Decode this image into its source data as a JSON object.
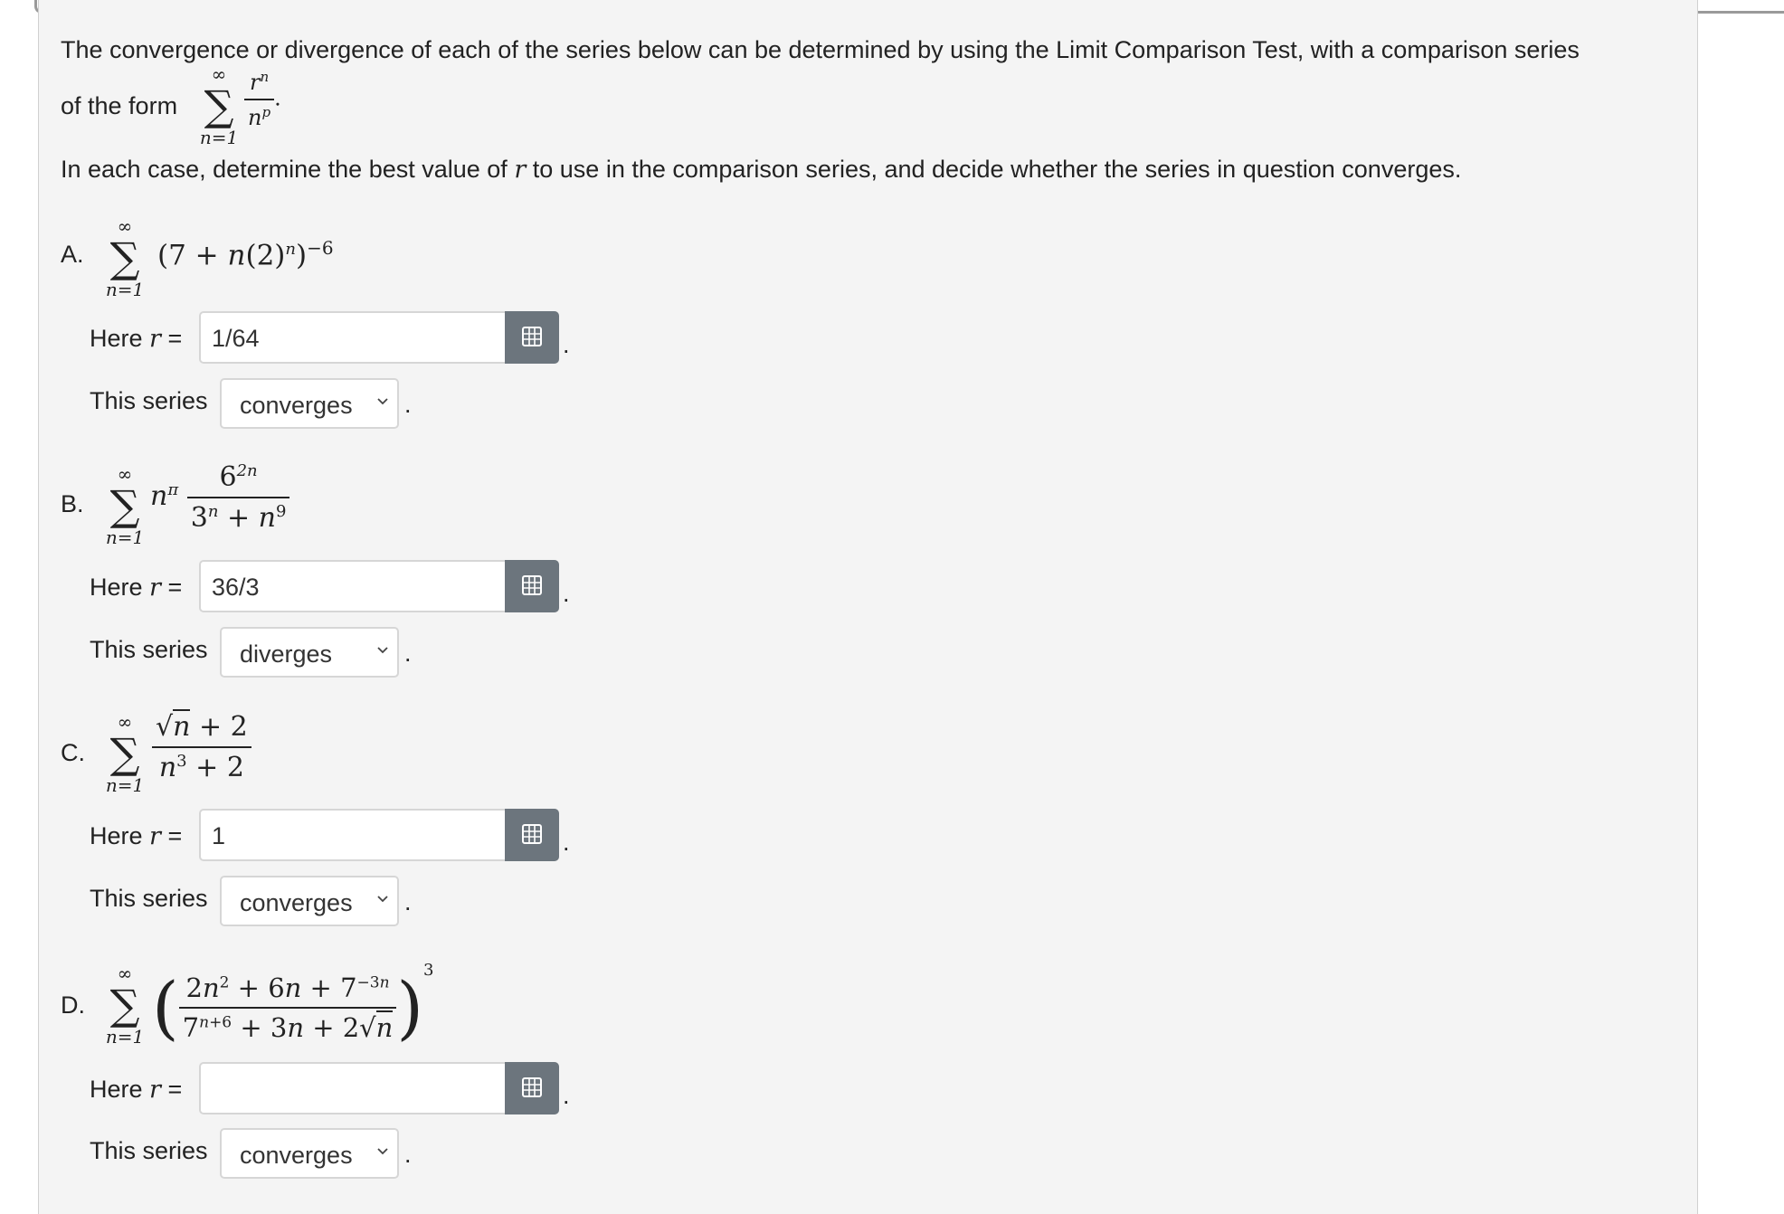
{
  "intro": {
    "line1": "The convergence or divergence of each of the series below can be determined by using the Limit Comparison Test, with a comparison series",
    "of_the_form": "of the form",
    "line2": "In each case, determine the best value of",
    "line2_var": "r",
    "line2_rest": "to use in the comparison series, and decide whether the series in question converges."
  },
  "labels": {
    "here_r_prefix": "Here",
    "here_r_var": "r",
    "here_r_eq": "=",
    "this_series": "This series",
    "period": "."
  },
  "parts": [
    {
      "letter": "A.",
      "r_value": "1/64",
      "dropdown": "converges"
    },
    {
      "letter": "B.",
      "r_value": "36/3",
      "dropdown": "diverges"
    },
    {
      "letter": "C.",
      "r_value": "1",
      "dropdown": "converges"
    },
    {
      "letter": "D.",
      "r_value": "",
      "dropdown": "converges"
    }
  ],
  "icons": {
    "input_button": "grid-icon",
    "dropdown": "chevron-down-icon"
  },
  "colors": {
    "button_bg": "#6c757d",
    "card_bg": "#f4f4f4"
  }
}
